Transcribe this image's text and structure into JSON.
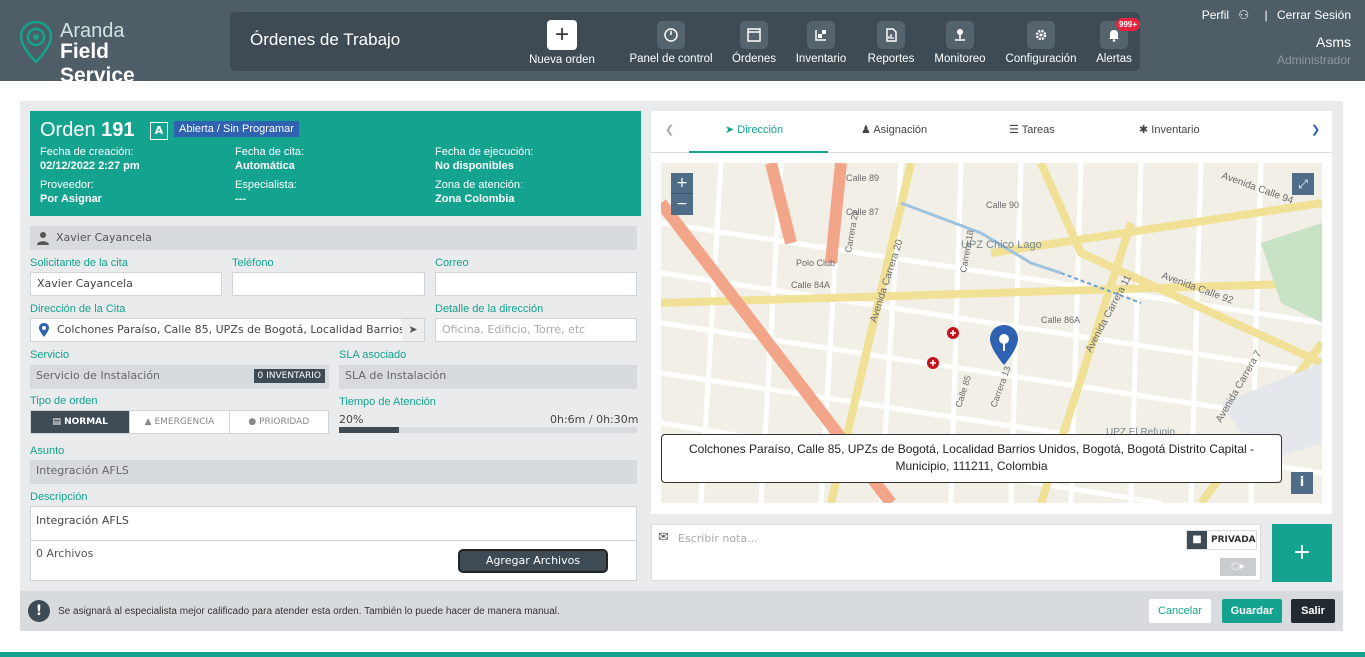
{
  "app": {
    "logo_line1": "Aranda",
    "logo_line2": "Field Service",
    "page_title": "Órdenes de Trabajo"
  },
  "nav": {
    "new_order": "Nueva orden",
    "items": [
      {
        "label": "Panel de control",
        "icon": "dashboard-icon"
      },
      {
        "label": "Órdenes",
        "icon": "orders-icon"
      },
      {
        "label": "Inventario",
        "icon": "inventory-icon"
      },
      {
        "label": "Reportes",
        "icon": "reports-icon"
      },
      {
        "label": "Monitoreo",
        "icon": "monitor-icon"
      },
      {
        "label": "Configuración",
        "icon": "gear-icon"
      },
      {
        "label": "Alertas",
        "icon": "bell-icon"
      }
    ],
    "alerts_badge": "999+"
  },
  "user": {
    "profile": "Perfil",
    "separator": "|",
    "logout": "Cerrar Sesión",
    "name": "Asms",
    "role": "Administrador"
  },
  "order": {
    "title_prefix": "Orden",
    "number": "191",
    "type_tag": "A",
    "status": "Abierta / Sin Programar",
    "created_label": "Fecha de creación:",
    "created_value": "02/12/2022 2:27 pm",
    "appointment_label": "Fecha de cita:",
    "appointment_value": "Automática",
    "execution_label": "Fecha de ejecución:",
    "execution_value": "No disponibles",
    "provider_label": "Proveedor:",
    "provider_value": "Por Asignar",
    "specialist_label": "Especialista:",
    "specialist_value": "---",
    "zone_label": "Zona de atención:",
    "zone_value": "Zona Colombia"
  },
  "form": {
    "client_name": "Xavier Cayancela",
    "requester_label": "Solicitante de la cita",
    "requester_value": "Xavier Cayancela",
    "phone_label": "Teléfono",
    "email_label": "Correo",
    "address_label": "Dirección de la Cita",
    "address_value": "Colchones Paraíso, Calle 85, UPZs de Bogotá, Localidad Barrios Unidos",
    "address_detail_label": "Detalle de la dirección",
    "address_detail_placeholder": "Oficina, Edificio, Torre, etc",
    "service_label": "Servicio",
    "service_value": "Servicio de Instalación",
    "inventory_badge": "0 INVENTARIO",
    "sla_label": "SLA asociado",
    "sla_value": "SLA de Instalación",
    "order_type_label": "Tipo de orden",
    "order_types": [
      "NORMAL",
      "EMERGENCIA",
      "PRIORIDAD"
    ],
    "attention_label": "Tiempo de Atención",
    "attention_percent": "20%",
    "attention_fraction": 0.2,
    "attention_time": "0h:6m / 0h:30m",
    "subject_label": "Asunto",
    "subject_value": "Integración AFLS",
    "description_label": "Descripción",
    "description_value": "Integración AFLS",
    "files_count": "0 Archivos",
    "add_files": "Agregar Archivos"
  },
  "tabs": [
    "Dirección",
    "Asignación",
    "Tareas",
    "Inventario"
  ],
  "map": {
    "address": "Colchones Paraíso, Calle 85, UPZs de Bogotá, Localidad Barrios Unidos, Bogotá, Bogotá Distrito Capital - Municipio, 111211, Colombia",
    "labels": [
      "Polo Club",
      "UPZ Chico Lago",
      "Avenida Carrera 20",
      "Avenida Calle 92",
      "Avenida Calle 94",
      "Avenida Carrera 11",
      "Calle 86A",
      "Calle 87",
      "Calle 89",
      "Calle 90",
      "Carrera 22",
      "UPZ El Refugio",
      "Carrera 13",
      "Calle 85",
      "Avenida Carrera 7",
      "Calle 84A",
      "Carrera 18"
    ],
    "zoom_in": "+",
    "zoom_out": "−",
    "info": "i"
  },
  "note": {
    "placeholder": "Escribir nota...",
    "private_label": "PRIVADA",
    "add": "+"
  },
  "footer": {
    "message": "Se asignará al especialista mejor calificado para atender esta orden. También lo puede hacer de manera manual.",
    "cancel": "Cancelar",
    "save": "Guardar",
    "exit": "Salir"
  },
  "colors": {
    "accent": "#14a38f",
    "dark": "#3e4b55",
    "status_blue": "#2f62b0",
    "alert_red": "#e5243f"
  }
}
